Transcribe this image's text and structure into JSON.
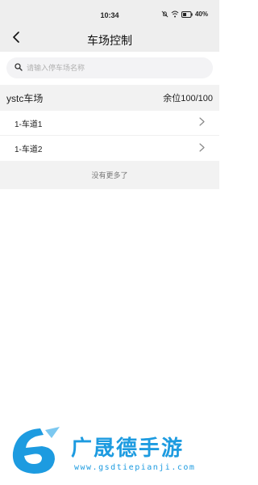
{
  "status_bar": {
    "time": "10:34",
    "battery": "40%",
    "icons": [
      "mute-icon",
      "wifi-icon",
      "battery-icon"
    ]
  },
  "header": {
    "title": "车场控制",
    "back_icon": "chevron-left-icon"
  },
  "search": {
    "placeholder": "请输入停车场名称",
    "value": ""
  },
  "lot": {
    "name": "ystc车场",
    "remaining": "余位100/100"
  },
  "lanes": [
    {
      "label": "1-车道1"
    },
    {
      "label": "1-车道2"
    }
  ],
  "footer": {
    "text": "没有更多了"
  },
  "watermark": {
    "brand": "广晟德手游",
    "url": "www.gsdtiepianji.com"
  },
  "colors": {
    "header_bg": "#eeeeee",
    "section_bg": "#f2f2f2",
    "watermark": "#1d9be0"
  }
}
